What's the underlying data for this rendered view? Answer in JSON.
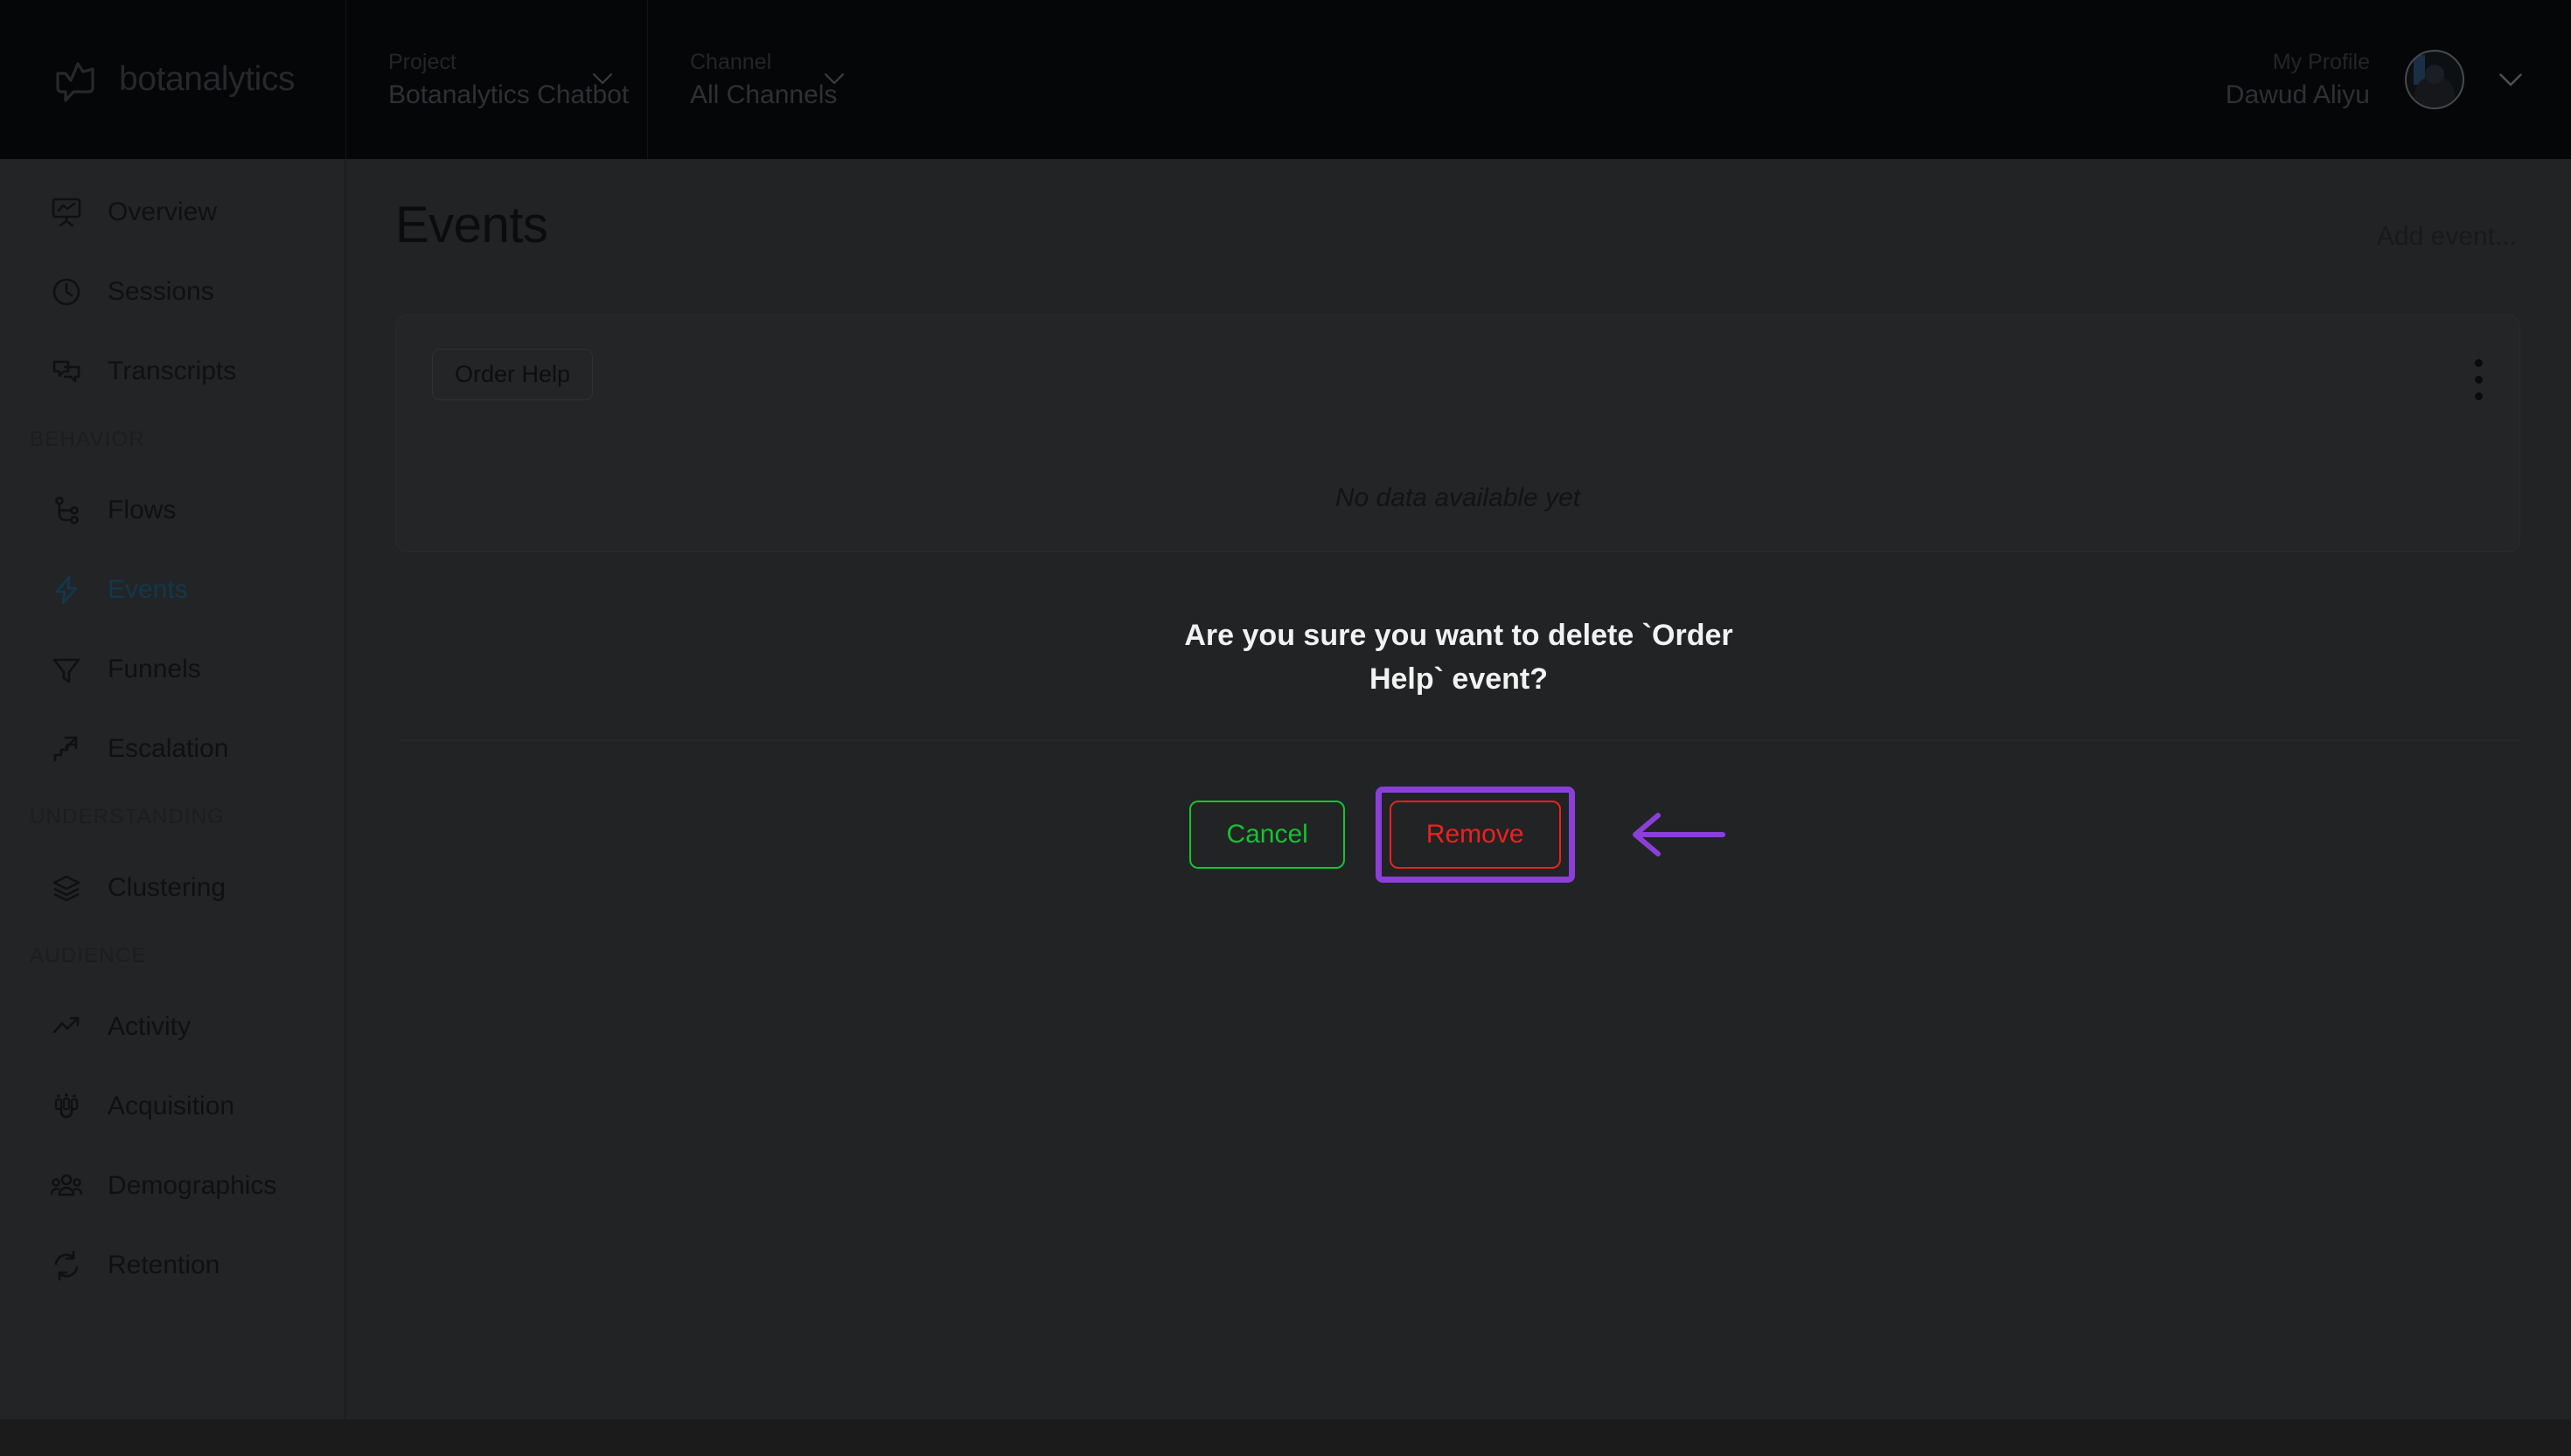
{
  "brand": {
    "name": "botanalytics",
    "logo_icon": "botanalytics-logo-icon"
  },
  "header": {
    "project": {
      "label": "Project",
      "value": "Botanalytics Chatbot",
      "chevron_icon": "chevron-down-icon"
    },
    "channel": {
      "label": "Channel",
      "value": "All Channels",
      "chevron_icon": "chevron-down-icon"
    },
    "profile": {
      "label": "My Profile",
      "value": "Dawud Aliyu",
      "avatar_icon": "avatar",
      "chevron_icon": "chevron-down-icon"
    }
  },
  "sidebar": {
    "items": [
      {
        "label": "Overview",
        "icon": "presentation-chart-icon",
        "active": false
      },
      {
        "label": "Sessions",
        "icon": "clock-icon",
        "active": false
      },
      {
        "label": "Transcripts",
        "icon": "chat-bubbles-icon",
        "active": false
      }
    ],
    "groups": [
      {
        "title": "BEHAVIOR",
        "items": [
          {
            "label": "Flows",
            "icon": "flow-tree-icon",
            "active": false
          },
          {
            "label": "Events",
            "icon": "lightning-icon",
            "active": true
          },
          {
            "label": "Funnels",
            "icon": "funnel-icon",
            "active": false
          },
          {
            "label": "Escalation",
            "icon": "stairs-up-arrow-icon",
            "active": false
          }
        ]
      },
      {
        "title": "UNDERSTANDING",
        "items": [
          {
            "label": "Clustering",
            "icon": "layers-icon",
            "active": false
          }
        ]
      },
      {
        "title": "AUDIENCE",
        "items": [
          {
            "label": "Activity",
            "icon": "trending-up-icon",
            "active": false
          },
          {
            "label": "Acquisition",
            "icon": "magnet-people-icon",
            "active": false
          },
          {
            "label": "Demographics",
            "icon": "people-group-icon",
            "active": false
          },
          {
            "label": "Retention",
            "icon": "refresh-cycle-icon",
            "active": false
          }
        ]
      }
    ]
  },
  "main": {
    "page_title": "Events",
    "add_event_label": "Add event...",
    "card": {
      "chip_label": "Order Help",
      "menu_icon": "kebab-menu-icon",
      "empty_text": "No data available yet"
    }
  },
  "confirm_dialog": {
    "message": "Are you sure you want to delete `Order Help` event?",
    "cancel_label": "Cancel",
    "remove_label": "Remove",
    "cancel_color": "#16c233",
    "remove_color": "#ef2020",
    "highlight_color": "#8b3fd9",
    "annotation_icon": "left-arrow-annotation-icon"
  }
}
